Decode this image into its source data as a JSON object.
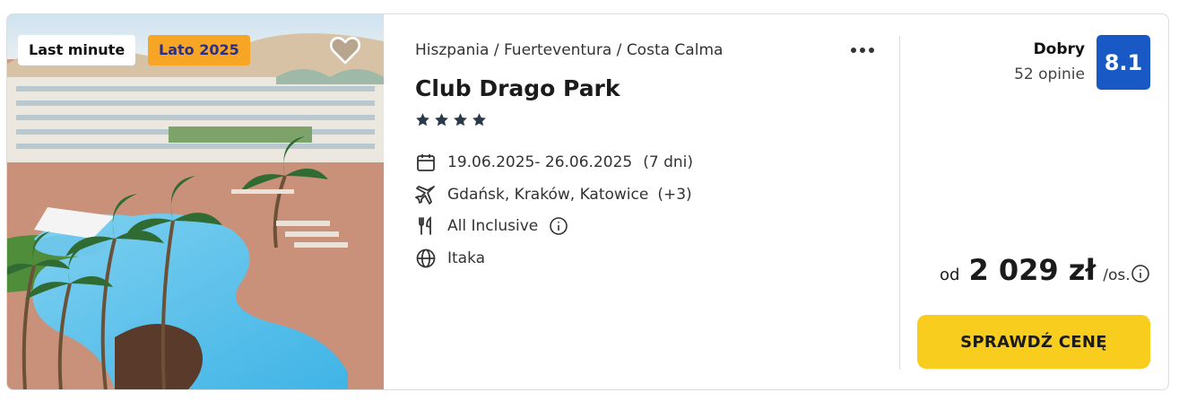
{
  "badges": {
    "last_minute": "Last minute",
    "season": "Lato 2025"
  },
  "hotel": {
    "breadcrumb": "Hiszpania / Fuerteventura / Costa Calma",
    "name": "Club Drago Park",
    "stars": 4
  },
  "details": {
    "dates": "19.06.2025- 26.06.2025",
    "nights": "(7 dni)",
    "airports": "Gdańsk, Kraków, Katowice",
    "airports_more": "(+3)",
    "board": "All Inclusive",
    "operator": "Itaka"
  },
  "rating": {
    "word": "Dobry",
    "count": "52 opinie",
    "score": "8.1"
  },
  "price": {
    "prefix": "od",
    "amount": "2 029 zł",
    "suffix": "/os."
  },
  "cta": {
    "label": "SPRAWDŹ CENĘ"
  },
  "icons": {
    "calendar": "calendar-icon",
    "plane": "plane-icon",
    "board": "cutlery-icon",
    "operator": "globe-icon",
    "info": "info-icon",
    "favorite": "heart-icon",
    "more": "more-dots-icon",
    "star": "star-icon"
  },
  "colors": {
    "rating_bg": "#1959c5",
    "cta_bg": "#f9cd1e",
    "season_badge_bg": "#f6a524",
    "season_badge_text": "#2a2f8a",
    "star": "#2b3a4a"
  }
}
